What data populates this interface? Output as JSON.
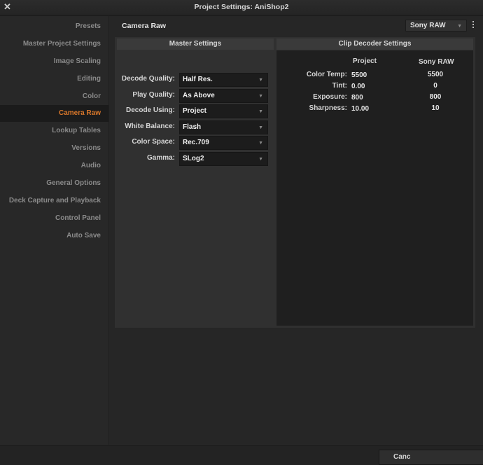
{
  "window": {
    "title": "Project Settings:  AniShop2"
  },
  "sidebar": {
    "items": [
      {
        "label": "Presets"
      },
      {
        "label": "Master Project Settings"
      },
      {
        "label": "Image Scaling"
      },
      {
        "label": "Editing"
      },
      {
        "label": "Color"
      },
      {
        "label": "Camera Raw",
        "active": true
      },
      {
        "label": "Lookup Tables"
      },
      {
        "label": "Versions"
      },
      {
        "label": "Audio"
      },
      {
        "label": "General Options"
      },
      {
        "label": "Deck Capture and Playback"
      },
      {
        "label": "Control Panel"
      },
      {
        "label": "Auto Save"
      }
    ]
  },
  "main": {
    "section_title": "Camera Raw",
    "raw_format": {
      "selected": "Sony RAW"
    }
  },
  "master_settings": {
    "header": "Master Settings",
    "fields": [
      {
        "label": "Decode Quality:",
        "value": "Half Res."
      },
      {
        "label": "Play Quality:",
        "value": "As Above"
      },
      {
        "label": "Decode Using:",
        "value": "Project"
      },
      {
        "label": "White Balance:",
        "value": "Flash"
      },
      {
        "label": "Color Space:",
        "value": "Rec.709"
      },
      {
        "label": "Gamma:",
        "value": "SLog2"
      }
    ]
  },
  "clip_decoder": {
    "header": "Clip Decoder Settings",
    "col_project": "Project",
    "col_sony": "Sony RAW",
    "rows": [
      {
        "label": "Color Temp:",
        "project": "5500",
        "sony": "5500"
      },
      {
        "label": "Tint:",
        "project": "0.00",
        "sony": "0"
      },
      {
        "label": "Exposure:",
        "project": "800",
        "sony": "800"
      },
      {
        "label": "Sharpness:",
        "project": "10.00",
        "sony": "10"
      }
    ]
  },
  "footer": {
    "cancel_label": "Canc"
  },
  "colors": {
    "accent": "#d9772a",
    "background": "#282828"
  }
}
